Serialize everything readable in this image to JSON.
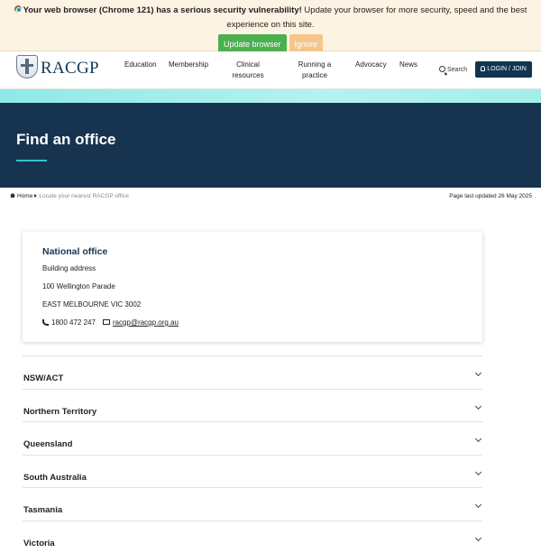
{
  "browser_warning": {
    "bold_text": "Your web browser (Chrome 121) has a serious security vulnerability!",
    "text": " Update your browser for more security, speed and the best experience on this site.",
    "update_label": "Update browser",
    "ignore_label": "Ignore"
  },
  "header": {
    "logo_text": "RACGP",
    "nav": [
      {
        "label": "Education"
      },
      {
        "label": "Membership"
      },
      {
        "label": "Clinical resources"
      },
      {
        "label": "Running a practice"
      },
      {
        "label": "Advocacy"
      },
      {
        "label": "News"
      }
    ],
    "search_label": "Search",
    "login_label": "LOGIN / JOIN"
  },
  "hero": {
    "title": "Find an office"
  },
  "breadcrumb": {
    "home": "Home",
    "current": "Locate your nearest RACGP office"
  },
  "page_updated": "Page last updated 26 May 2025",
  "national_office": {
    "name": "National office",
    "address_label": "Building address",
    "street": "100 Wellington Parade",
    "city": "EAST MELBOURNE VIC 3002",
    "phone": "1800 472 247",
    "email": "racgp@racgp.org.au"
  },
  "regions": [
    {
      "label": "NSW/ACT"
    },
    {
      "label": "Northern Territory"
    },
    {
      "label": "Queensland"
    },
    {
      "label": "South Australia"
    },
    {
      "label": "Tasmania"
    },
    {
      "label": "Victoria"
    }
  ],
  "colors": {
    "hero_bg": "#163450",
    "accent": "#35c3c9",
    "update_button": "#4caf50",
    "ignore_button": "#f5c68b"
  }
}
